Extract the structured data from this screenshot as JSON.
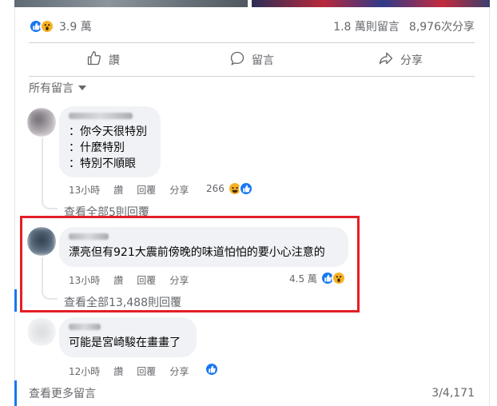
{
  "post": {
    "reaction_count": "3.9 萬",
    "comment_count": "1.8 萬則留言",
    "share_count": "8,976次分享"
  },
  "actions": {
    "like": "讚",
    "comment": "留言",
    "share": "分享"
  },
  "sort": {
    "label": "所有留言"
  },
  "comments": [
    {
      "body": "：你今天很特別\n：什麼特別\n：特別不順眼",
      "time": "13小時",
      "like": "讚",
      "reply": "回覆",
      "share": "分享",
      "reaction_count": "266",
      "view_replies": "查看全部5則回覆"
    },
    {
      "body": "漂亮但有921大震前傍晚的味道怕怕的要小心注意的",
      "time": "13小時",
      "like": "讚",
      "reply": "回覆",
      "share": "分享",
      "reaction_count": "4.5 萬",
      "view_replies": "查看全部13,488則回覆"
    },
    {
      "body": "可能是宮崎駿在畫畫了",
      "time": "12小時",
      "like": "讚",
      "reply": "回覆",
      "share": "分享"
    }
  ],
  "footer": {
    "view_more": "查看更多留言",
    "pagination": "3/4,171"
  },
  "colors": {
    "brand_blue": "#1877f2",
    "highlight_red": "#e41e26",
    "secondary_text": "#65676b",
    "bubble_bg": "#f0f2f5"
  },
  "icons": [
    "like-icon",
    "wow-icon",
    "haha-icon",
    "comment-icon",
    "share-icon",
    "chevron-down-icon"
  ]
}
